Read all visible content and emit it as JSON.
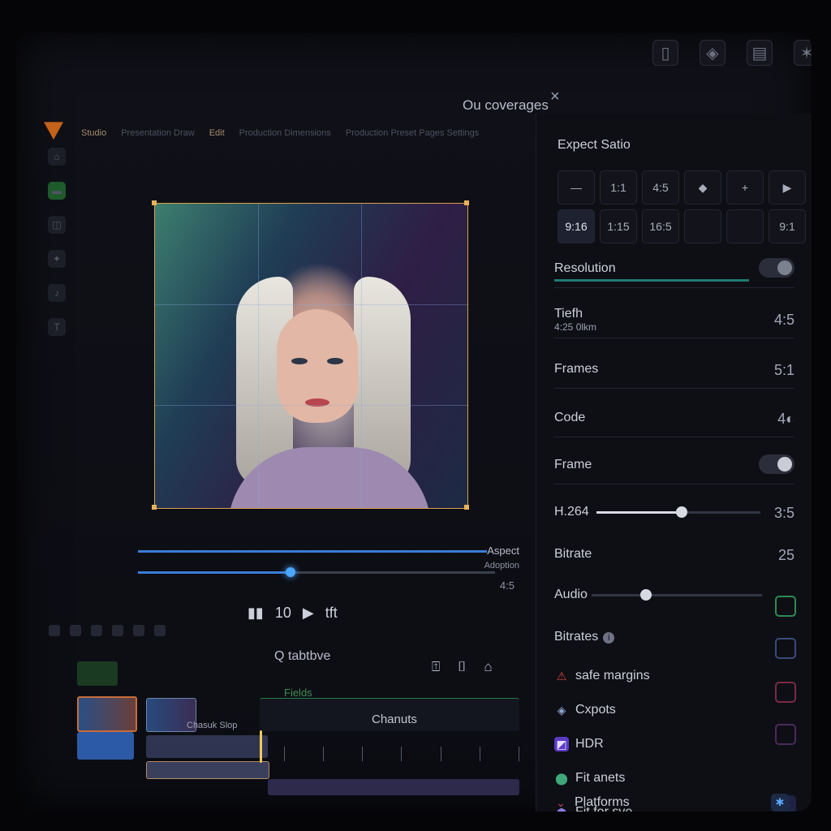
{
  "header": {
    "tabs": [
      "Studio",
      "Presentation Draw",
      "Edit",
      "Production Dimensions",
      "Production Preset Pages Settings"
    ],
    "coverage_label": "Ou coverages",
    "close_label": "×"
  },
  "top_icons": [
    "document-icon",
    "badge-icon",
    "book-icon",
    "star-icon"
  ],
  "preview": {
    "aspect_label": "Aspect",
    "aspect_sub": "Adoption",
    "aspect_value": "4:5"
  },
  "transport": {
    "labels": [
      "10",
      "tft"
    ]
  },
  "timeline": {
    "title": "Q tabtbve",
    "clip_fields": "Fields",
    "clip_chanuts": "Chanuts",
    "clip_demo": "Chasuk Slop"
  },
  "panel": {
    "aspect_title": "Expect Satio",
    "ratios": [
      {
        "label": "—",
        "active": false
      },
      {
        "label": "1:1",
        "active": false
      },
      {
        "label": "4:5",
        "active": false
      },
      {
        "label": "◆",
        "active": false
      },
      {
        "label": "+",
        "active": false
      },
      {
        "label": "▶",
        "active": false
      },
      {
        "label": "9:16",
        "active": true
      },
      {
        "label": "1:15",
        "active": false
      },
      {
        "label": "16:5",
        "active": false
      },
      {
        "label": "",
        "active": false
      },
      {
        "label": "",
        "active": false
      },
      {
        "label": "9:1",
        "active": false
      }
    ],
    "resolution_label": "Resolution",
    "tiefh_label": "Tiefh",
    "tiefh_sub": "4:25 0lkm",
    "tiefh_value": "4:5",
    "frames_label": "Frames",
    "frames_value": "5:1",
    "code_label": "Code",
    "code_value": "4◐",
    "frame_label": "Frame",
    "h264_label": "H.264",
    "h264_value": "3:5",
    "h264_slider": 0.52,
    "bitrate_label": "Bitrate",
    "bitrate_value": "25",
    "audio_label": "Audio",
    "audio_slider": 0.32,
    "bitrates_label": "Bitrates",
    "info_label": "i",
    "features": [
      {
        "label": "safe margins",
        "icon": "warning-icon",
        "color": "#d2463f"
      },
      {
        "label": "Cxpots",
        "icon": "export-icon",
        "color": "#8fa6d6"
      },
      {
        "label": "HDR",
        "icon": "hdr-icon",
        "color": "#7a4ce0"
      },
      {
        "label": "Fit anets",
        "icon": "fit-icon",
        "color": "#3fa87a"
      },
      {
        "label": "Fit for sve",
        "icon": "fitsave-icon",
        "color": "#8b7ae0"
      },
      {
        "label": "Platforms",
        "icon": "platforms-icon",
        "color": "#c34060"
      }
    ]
  },
  "colors": {
    "accent": "#3a7dd6",
    "crop": "#d9a04c",
    "teal": "#1f7a73"
  }
}
